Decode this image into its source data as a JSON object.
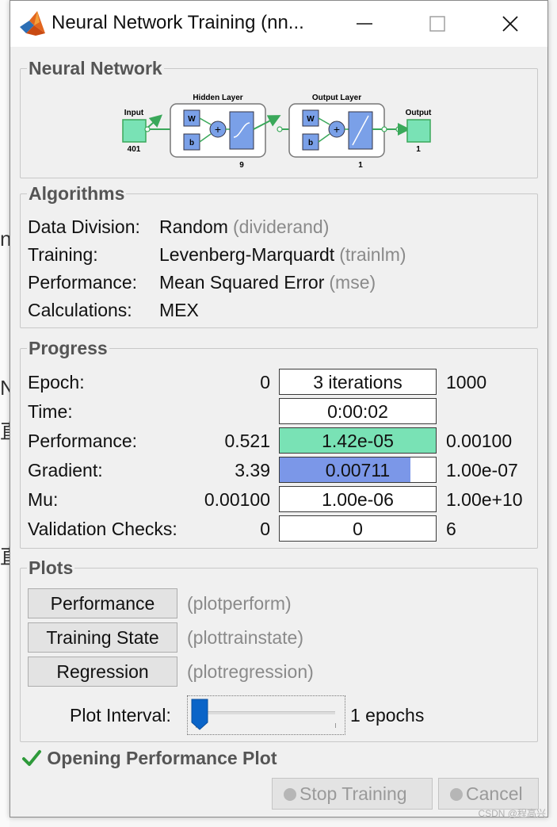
{
  "window": {
    "title": "Neural Network Training (nn..."
  },
  "background": {
    "glyphs": [
      "n",
      "N",
      "直",
      "直"
    ]
  },
  "network": {
    "title": "Neural Network",
    "input_label": "Input",
    "input_size": "401",
    "hidden_label": "Hidden Layer",
    "hidden_size": "9",
    "output_layer_label": "Output Layer",
    "output_layer_size": "1",
    "output_label": "Output",
    "output_size": "1",
    "w_label": "W",
    "b_label": "b",
    "plus_label": "+"
  },
  "algorithms": {
    "title": "Algorithms",
    "rows": [
      {
        "key": "Data Division:",
        "value": "Random",
        "sub": "(dividerand)"
      },
      {
        "key": "Training:",
        "value": "Levenberg-Marquardt",
        "sub": "(trainlm)"
      },
      {
        "key": "Performance:",
        "value": "Mean Squared Error",
        "sub": "(mse)"
      },
      {
        "key": "Calculations:",
        "value": "MEX",
        "sub": ""
      }
    ]
  },
  "progress": {
    "title": "Progress",
    "rows": [
      {
        "label": "Epoch:",
        "min": "0",
        "value": "3 iterations",
        "max": "1000",
        "fill": 0,
        "color": "#ffffff"
      },
      {
        "label": "Time:",
        "min": "",
        "value": "0:00:02",
        "max": "",
        "fill": 0,
        "color": "#ffffff"
      },
      {
        "label": "Performance:",
        "min": "0.521",
        "value": "1.42e-05",
        "max": "0.00100",
        "fill": 1.0,
        "color": "#79e2b5"
      },
      {
        "label": "Gradient:",
        "min": "3.39",
        "value": "0.00711",
        "max": "1.00e-07",
        "fill": 0.84,
        "color": "#7b97e8"
      },
      {
        "label": "Mu:",
        "min": "0.00100",
        "value": "1.00e-06",
        "max": "1.00e+10",
        "fill": 0,
        "color": "#ffffff"
      },
      {
        "label": "Validation Checks:",
        "min": "0",
        "value": "0",
        "max": "6",
        "fill": 0,
        "color": "#ffffff"
      }
    ]
  },
  "plots": {
    "title": "Plots",
    "buttons": [
      {
        "label": "Performance",
        "sub": "(plotperform)"
      },
      {
        "label": "Training State",
        "sub": "(plottrainstate)"
      },
      {
        "label": "Regression",
        "sub": "(plotregression)"
      }
    ],
    "interval_label": "Plot Interval:",
    "interval_value": "1 epochs",
    "interval_level": 0
  },
  "status": {
    "text": "Opening Performance Plot"
  },
  "buttons": {
    "stop": "Stop Training",
    "cancel": "Cancel"
  },
  "watermark": "CSDN @程高兴",
  "colors": {
    "layer_box": "#7aa0e8",
    "node_green": "#79e2b5",
    "arrow_green": "#3aa85a"
  }
}
